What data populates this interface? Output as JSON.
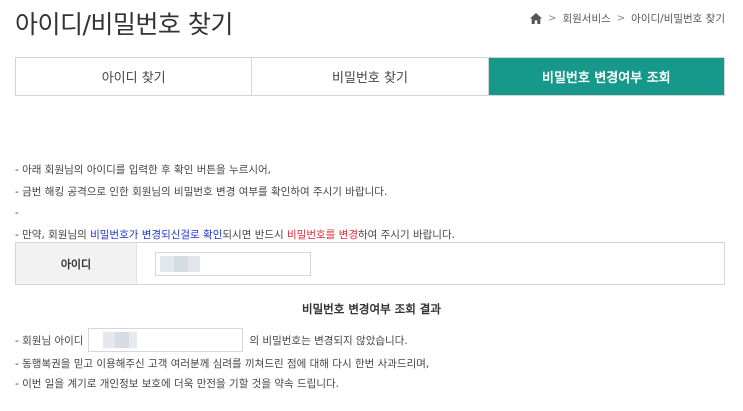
{
  "header": {
    "title": "아이디/비밀번호 찾기",
    "breadcrumb": [
      "회원서비스",
      "아이디/비밀번호 찾기"
    ],
    "separator": ">"
  },
  "tabs": [
    {
      "label": "아이디 찾기"
    },
    {
      "label": "비밀번호 찾기"
    },
    {
      "label": "비밀번호 변경여부 조회"
    }
  ],
  "notice": {
    "line1": "- 아래 회원님의 아이디를 입력한 후 확인 버튼을 누르시어,",
    "line2": "- 금번 해킹 공격으로 인한 회원님의 비밀번호 변경 여부를 확인하여 주시기 바랍니다.",
    "line3": "-",
    "line4_a": "- 만약, 회원님의 ",
    "line4_b": "비밀번호가 변경되신걸로 확인",
    "line4_c": "되시면 반드시 ",
    "line4_d": "비밀번호를 변경",
    "line4_e": "하여 주시기 바랍니다."
  },
  "id_form": {
    "label": "아이디",
    "value": ""
  },
  "result": {
    "title": "비밀번호 변경여부 조회 결과",
    "prefix": "- 회원님 아이디",
    "suffix": "의 비밀번호는 변경되지 않았습니다.",
    "value": "",
    "line2": "- 동행복권을 믿고 이용해주신 고객 여러분께 심려를 끼쳐드린 점에 대해 다시 한번 사과드리며,",
    "line3": "- 이번 일을 계기로 개인정보 보호에 더욱 만전을 기할 것을 약속 드립니다."
  },
  "colors": {
    "accent": "#16988a",
    "highlight_blue": "#2233cc",
    "highlight_red": "#e0293a"
  }
}
